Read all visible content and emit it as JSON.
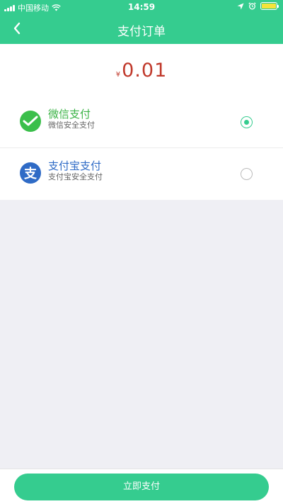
{
  "status_bar": {
    "carrier": "中国移动",
    "time": "14:59",
    "battery_level": 1.0
  },
  "nav": {
    "title": "支付订单",
    "back_icon": "chevron-left-icon"
  },
  "order": {
    "currency": "¥",
    "amount": "0.01"
  },
  "payment_methods": [
    {
      "name": "微信支付",
      "desc": "微信安全支付",
      "icon": "wechat-pay-icon",
      "selected": true,
      "color": "#3bb346"
    },
    {
      "name": "支付宝支付",
      "desc": "支付宝安全支付",
      "icon": "alipay-icon",
      "icon_glyph": "支",
      "selected": false,
      "color": "#2f6bc6"
    }
  ],
  "footer": {
    "pay_label": "立即支付"
  },
  "colors": {
    "brand": "#35cc8f",
    "amount": "#c0392b",
    "background": "#efeff4"
  }
}
